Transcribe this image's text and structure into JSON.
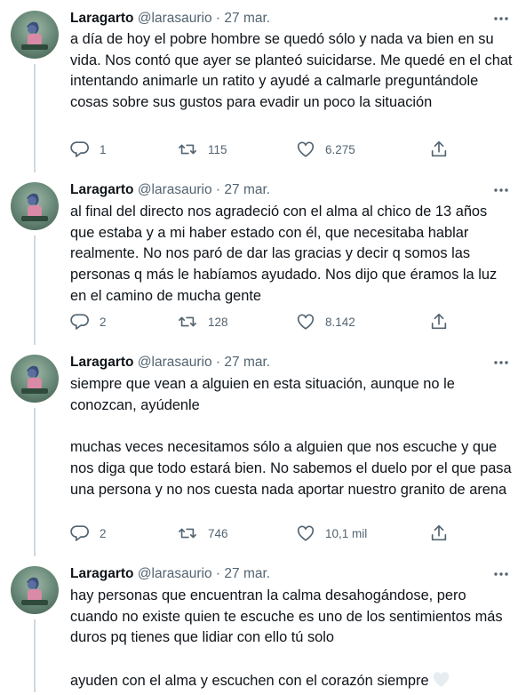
{
  "tweets": [
    {
      "name": "Laragarto",
      "handle": "@larasaurio",
      "sep": "·",
      "date": "27 mar.",
      "more": "•••",
      "paragraphs": [
        "a día de hoy el pobre hombre se quedó sólo y nada va bien en su vida. Nos contó que ayer se planteó suicidarse. Me quedé en el chat intentando animarle un ratito y ayudé a calmarle preguntándole cosas sobre sus gustos para evadir un poco la situación"
      ],
      "replies": "1",
      "retweets": "115",
      "likes": "6.275"
    },
    {
      "name": "Laragarto",
      "handle": "@larasaurio",
      "sep": "·",
      "date": "27 mar.",
      "more": "•••",
      "paragraphs": [
        "al final del directo nos agradeció con el alma al chico de 13 años que estaba y a mi haber estado con él, que necesitaba hablar realmente. No nos paró de dar las gracias y decir q somos las personas q más le habíamos ayudado. Nos dijo que éramos la luz en el camino de mucha gente"
      ],
      "replies": "2",
      "retweets": "128",
      "likes": "8.142"
    },
    {
      "name": "Laragarto",
      "handle": "@larasaurio",
      "sep": "·",
      "date": "27 mar.",
      "more": "•••",
      "paragraphs": [
        "siempre que vean a alguien en esta situación, aunque no le conozcan, ayúdenle",
        "muchas veces necesitamos sólo a alguien que nos escuche y que nos diga que todo estará bien. No sabemos el duelo por el que pasa una persona y no nos cuesta nada aportar nuestro granito de arena"
      ],
      "replies": "2",
      "retweets": "746",
      "likes": "10,1 mil"
    },
    {
      "name": "Laragarto",
      "handle": "@larasaurio",
      "sep": "·",
      "date": "27 mar.",
      "more": "•••",
      "paragraphs": [
        "hay personas que encuentran la calma desahogándose, pero cuando no existe quien te escuche es uno de los sentimientos más duros pq tienes que lidiar con ello tú solo",
        "ayuden con el alma y escuchen con el corazón siempre"
      ],
      "trailing_emoji": "white-heart-icon"
    }
  ],
  "colors": {
    "text": "#0f1419",
    "secondary": "#536471",
    "thread_line": "#cfd9de",
    "heart_emoji": "#e6ecf0"
  }
}
